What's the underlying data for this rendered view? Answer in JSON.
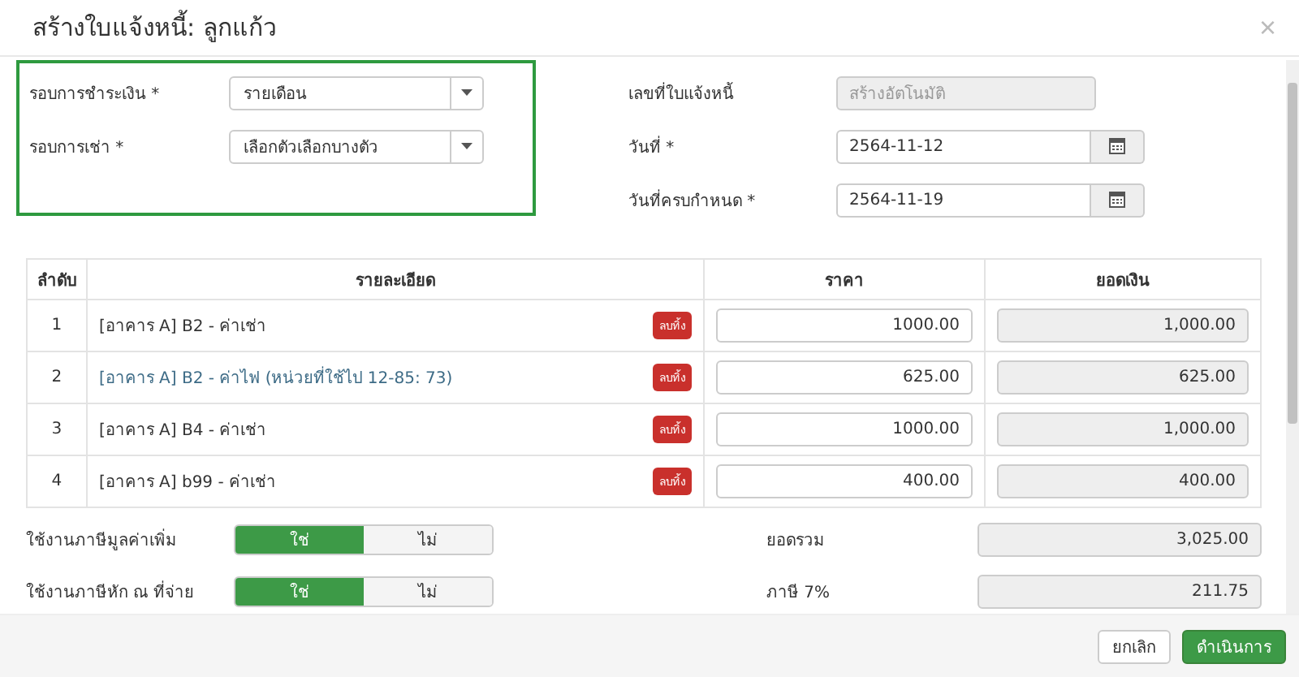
{
  "dialog": {
    "title": "สร้างใบแจ้งหนี้: ลูกแก้ว",
    "close": "×"
  },
  "billing": {
    "fields": [
      {
        "label": "รอบการชำระเงิน *",
        "value": "รายเดือน"
      },
      {
        "label": "รอบการเช่า *",
        "value": "เลือกตัวเลือกบางตัว"
      }
    ]
  },
  "invoice": {
    "fields": [
      {
        "kind": "readonly",
        "label": "เลขที่ใบแจ้งหนี้",
        "placeholder": "สร้างอัตโนมัติ"
      },
      {
        "kind": "date",
        "label": "วันที่ *",
        "value": "2564-11-12"
      },
      {
        "kind": "date",
        "label": "วันที่ครบกำหนด *",
        "value": "2564-11-19"
      }
    ]
  },
  "table": {
    "columns": [
      "ลำดับ",
      "รายละเอียด",
      "ราคา",
      "ยอดเงิน"
    ],
    "rows": [
      {
        "index": "1",
        "detail": "[อาคาร A] B2 - ค่าเช่า",
        "highlighted": false,
        "delete": "ลบทิ้ง",
        "price": "1000.00",
        "amount": "1,000.00"
      },
      {
        "index": "2",
        "detail": "[อาคาร A] B2 - ค่าไฟ (หน่วยที่ใช้ไป 12-85: 73)",
        "highlighted": true,
        "delete": "ลบทิ้ง",
        "price": "625.00",
        "amount": "625.00"
      },
      {
        "index": "3",
        "detail": "[อาคาร A] B4 - ค่าเช่า",
        "highlighted": false,
        "delete": "ลบทิ้ง",
        "price": "1000.00",
        "amount": "1,000.00"
      },
      {
        "index": "4",
        "detail": "[อาคาร A] b99 - ค่าเช่า",
        "highlighted": false,
        "delete": "ลบทิ้ง",
        "price": "400.00",
        "amount": "400.00"
      }
    ]
  },
  "options": [
    {
      "label": "ใช้งานภาษีมูลค่าเพิ่ม",
      "choices": [
        {
          "label": "ใช่",
          "selected": true
        },
        {
          "label": "ไม่",
          "selected": false
        }
      ]
    },
    {
      "label": "ใช้งานภาษีหัก ณ ที่จ่าย",
      "choices": [
        {
          "label": "ใช่",
          "selected": true
        },
        {
          "label": "ไม่",
          "selected": false
        }
      ]
    }
  ],
  "totals": [
    {
      "label": "ยอดรวม",
      "value": "3,025.00"
    },
    {
      "label": "ภาษี 7%",
      "value": "211.75"
    }
  ],
  "footer": {
    "buttons": [
      {
        "label": "ยกเลิก",
        "kind": "default"
      },
      {
        "label": "ดำเนินการ",
        "kind": "primary"
      }
    ]
  }
}
